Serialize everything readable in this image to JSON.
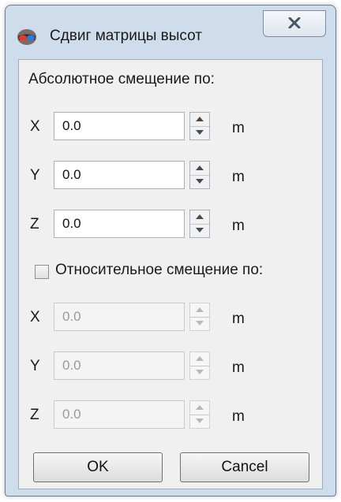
{
  "window": {
    "title": "Сдвиг матрицы высот"
  },
  "absolute": {
    "heading": "Абсолютное смещение по:",
    "rows": [
      {
        "axis": "X",
        "value": "0.0",
        "unit": "m"
      },
      {
        "axis": "Y",
        "value": "0.0",
        "unit": "m"
      },
      {
        "axis": "Z",
        "value": "0.0",
        "unit": "m"
      }
    ]
  },
  "relative": {
    "checkbox_label": "Относительное смещение по:",
    "checked": false,
    "rows": [
      {
        "axis": "X",
        "value": "0.0",
        "unit": "m"
      },
      {
        "axis": "Y",
        "value": "0.0",
        "unit": "m"
      },
      {
        "axis": "Z",
        "value": "0.0",
        "unit": "m"
      }
    ]
  },
  "buttons": {
    "ok": "OK",
    "cancel": "Cancel"
  }
}
